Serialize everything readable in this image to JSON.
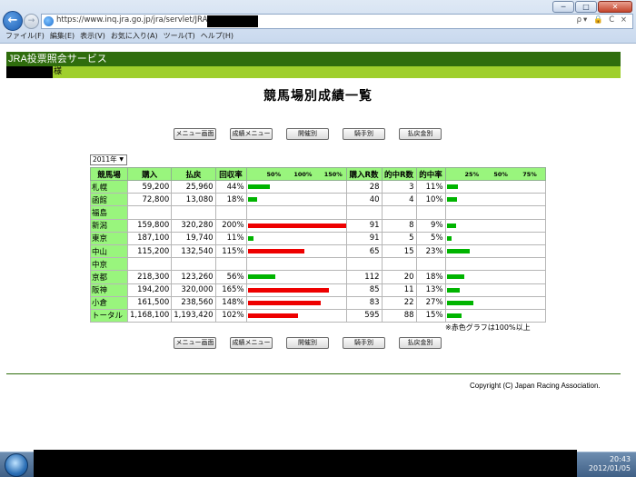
{
  "browser": {
    "url": "https://www.inq.jra.go.jp/jra/servlet/JRA",
    "address_tools": "ρ▾ 🔒 C ×",
    "window_buttons": [
      "─",
      "□",
      "✕"
    ],
    "menu": [
      "ファイル(F)",
      "編集(E)",
      "表示(V)",
      "お気に入り(A)",
      "ツール(T)",
      "ヘルプ(H)"
    ]
  },
  "header": {
    "service_title": "JRA投票照会サービス",
    "user_suffix": "様"
  },
  "page_title": "競馬場別成績一覧",
  "nav_buttons": [
    "メニュー画面",
    "成績メニュー",
    "開催別",
    "騎手別",
    "払戻金別"
  ],
  "year_select": {
    "value": "2011年"
  },
  "table": {
    "headers": [
      "競馬場",
      "購入",
      "払戻",
      "回収率",
      "",
      "購入R数",
      "的中R数",
      "的中率",
      ""
    ],
    "rate_scale": [
      "50%",
      "100%",
      "150%"
    ],
    "hit_scale": [
      "25%",
      "50%",
      "75%"
    ],
    "rows": [
      {
        "name": "札幌",
        "buy": "59,200",
        "payout": "25,960",
        "rate": "44%",
        "rate_value": 44,
        "races": "28",
        "hits": "3",
        "hit_rate": "11%",
        "hit_value": 11
      },
      {
        "name": "函館",
        "buy": "72,800",
        "payout": "13,080",
        "rate": "18%",
        "rate_value": 18,
        "races": "40",
        "hits": "4",
        "hit_rate": "10%",
        "hit_value": 10
      },
      {
        "name": "福島",
        "buy": "",
        "payout": "",
        "rate": "",
        "rate_value": 0,
        "races": "",
        "hits": "",
        "hit_rate": "",
        "hit_value": 0
      },
      {
        "name": "新潟",
        "buy": "159,800",
        "payout": "320,280",
        "rate": "200%",
        "rate_value": 200,
        "races": "91",
        "hits": "8",
        "hit_rate": "9%",
        "hit_value": 9
      },
      {
        "name": "東京",
        "buy": "187,100",
        "payout": "19,740",
        "rate": "11%",
        "rate_value": 11,
        "races": "91",
        "hits": "5",
        "hit_rate": "5%",
        "hit_value": 5
      },
      {
        "name": "中山",
        "buy": "115,200",
        "payout": "132,540",
        "rate": "115%",
        "rate_value": 115,
        "races": "65",
        "hits": "15",
        "hit_rate": "23%",
        "hit_value": 23
      },
      {
        "name": "中京",
        "buy": "",
        "payout": "",
        "rate": "",
        "rate_value": 0,
        "races": "",
        "hits": "",
        "hit_rate": "",
        "hit_value": 0
      },
      {
        "name": "京都",
        "buy": "218,300",
        "payout": "123,260",
        "rate": "56%",
        "rate_value": 56,
        "races": "112",
        "hits": "20",
        "hit_rate": "18%",
        "hit_value": 18
      },
      {
        "name": "阪神",
        "buy": "194,200",
        "payout": "320,000",
        "rate": "165%",
        "rate_value": 165,
        "races": "85",
        "hits": "11",
        "hit_rate": "13%",
        "hit_value": 13
      },
      {
        "name": "小倉",
        "buy": "161,500",
        "payout": "238,560",
        "rate": "148%",
        "rate_value": 148,
        "races": "83",
        "hits": "22",
        "hit_rate": "27%",
        "hit_value": 27
      },
      {
        "name": "トータル",
        "buy": "1,168,100",
        "payout": "1,193,420",
        "rate": "102%",
        "rate_value": 102,
        "races": "595",
        "hits": "88",
        "hit_rate": "15%",
        "hit_value": 15
      }
    ]
  },
  "note": "※赤色グラフは100%以上",
  "colors": {
    "bar_red": "#ee0000",
    "bar_green": "#00b400",
    "header_green": "#99f57d",
    "service_dark": "#2f6d0d",
    "service_light": "#9fcf2c"
  },
  "copyright": "Copyright (C) Japan Racing Association.",
  "taskbar": {
    "time": "20:43",
    "date": "2012/01/05"
  }
}
